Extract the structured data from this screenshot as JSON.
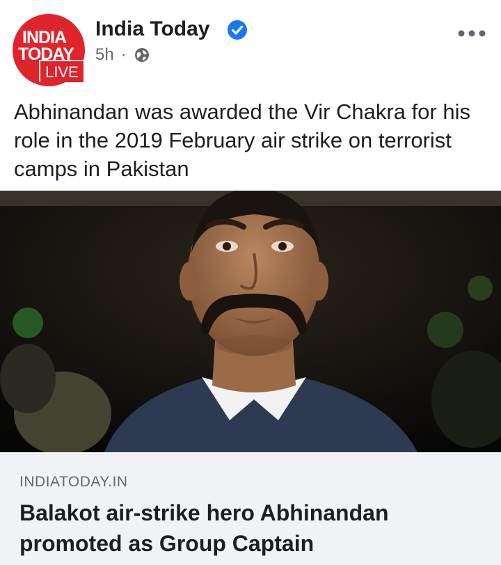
{
  "post": {
    "page_name": "India Today",
    "avatar_line1": "INDIA",
    "avatar_line2": "TODAY",
    "avatar_badge": "LIVE",
    "time": "5h",
    "separator": "·",
    "privacy_icon": "globe-icon",
    "verified_icon": "verified-check-icon",
    "more_icon": "more-options-icon",
    "text": "Abhinandan was awarded the Vir Chakra for his role in the 2019 February air strike on terrorist camps in Pakistan"
  },
  "link_preview": {
    "domain": "INDIATODAY.IN",
    "title": "Balakot air-strike hero Abhinandan promoted as Group Captain"
  },
  "colors": {
    "brand_red": "#e0242c",
    "verified_blue": "#1877f2",
    "secondary_text": "#65676b",
    "preview_bg": "#f0f2f5"
  }
}
